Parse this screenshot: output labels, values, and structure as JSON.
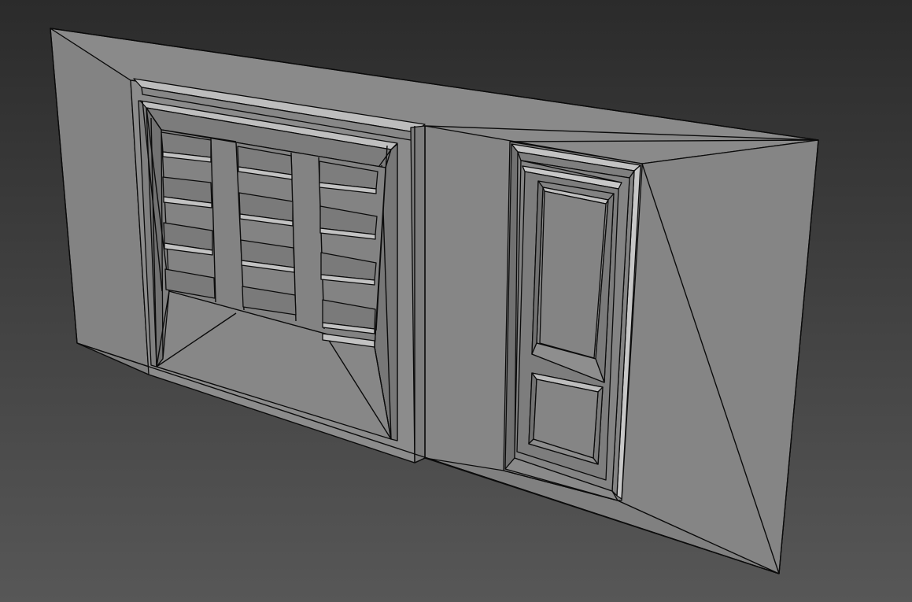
{
  "viewport": {
    "background_top": "#2b2b2b",
    "background_bottom": "#565656",
    "wire_color": "#0b0b0b",
    "shade_base": "#838383",
    "shade_light": "#bdbdbd",
    "shade_dark": "#6e6e6e"
  },
  "scene": {
    "objects": [
      "garage-door",
      "entry-door",
      "wall-panel"
    ]
  }
}
